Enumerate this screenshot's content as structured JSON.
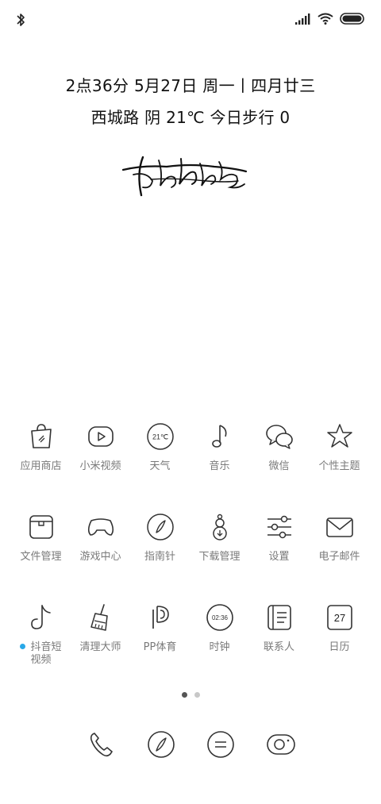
{
  "status_bar": {
    "icons": [
      "bluetooth-icon",
      "signal-icon",
      "wifi-icon",
      "battery-icon"
    ]
  },
  "lockinfo": {
    "line1": "2点36分  5月27日 周一丨四月廿三",
    "line2": "西城路 阴 21℃  今日步行 0"
  },
  "apps": [
    {
      "label": "应用商店",
      "icon": "shopping-bag-icon"
    },
    {
      "label": "小米视频",
      "icon": "video-play-icon"
    },
    {
      "label": "天气",
      "icon": "weather-icon",
      "icon_text": "21℃"
    },
    {
      "label": "音乐",
      "icon": "music-note-icon"
    },
    {
      "label": "微信",
      "icon": "chat-bubbles-icon"
    },
    {
      "label": "个性主题",
      "icon": "star-icon"
    },
    {
      "label": "文件管理",
      "icon": "folder-box-icon"
    },
    {
      "label": "游戏中心",
      "icon": "gamepad-icon"
    },
    {
      "label": "指南针",
      "icon": "compass-icon"
    },
    {
      "label": "下载管理",
      "icon": "download-gourd-icon"
    },
    {
      "label": "设置",
      "icon": "sliders-icon"
    },
    {
      "label": "电子邮件",
      "icon": "envelope-icon"
    },
    {
      "label": "抖音短",
      "label2": "视频",
      "icon": "tiktok-icon",
      "new_dot_color": "#29a8e8"
    },
    {
      "label": "清理大师",
      "icon": "broom-icon"
    },
    {
      "label": "PP体育",
      "icon": "pp-sports-icon"
    },
    {
      "label": "时钟",
      "icon": "clock-icon",
      "icon_text": "02:36"
    },
    {
      "label": "联系人",
      "icon": "contacts-book-icon"
    },
    {
      "label": "日历",
      "icon": "calendar-icon",
      "icon_text": "27"
    }
  ],
  "pager": {
    "pages": 2,
    "current": 1
  },
  "dock": [
    {
      "icon": "phone-icon"
    },
    {
      "icon": "browser-compass-icon"
    },
    {
      "icon": "message-icon"
    },
    {
      "icon": "camera-icon"
    }
  ]
}
